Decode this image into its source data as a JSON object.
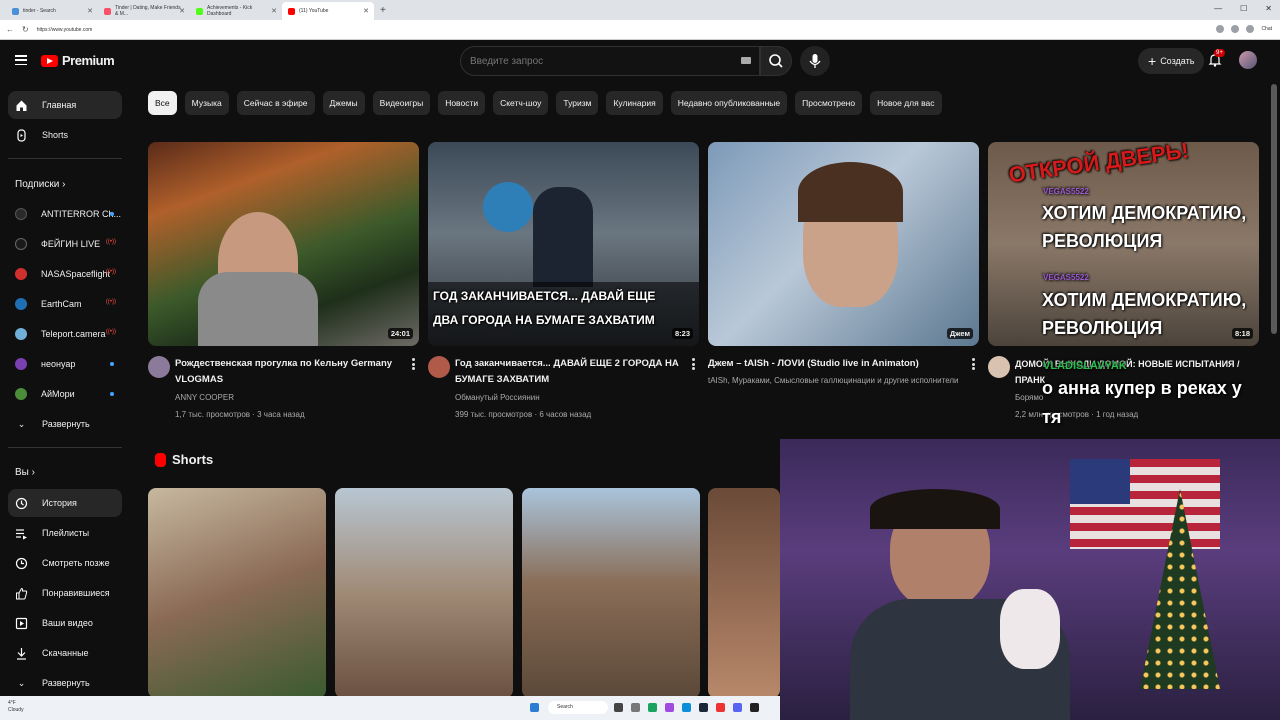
{
  "browser": {
    "tabs": [
      {
        "label": "tinder - Search",
        "active": false,
        "favicon_color": "#4a90d9"
      },
      {
        "label": "Tinder | Dating, Make Friends & M...",
        "active": false,
        "favicon_color": "#fd5068"
      },
      {
        "label": "Achievements - Kick Dashboard",
        "active": false,
        "favicon_color": "#53fc18"
      },
      {
        "label": "(11) YouTube",
        "active": true,
        "favicon_color": "#ff0000"
      }
    ],
    "new_tab": "+",
    "url": "https://www.youtube.com",
    "chat_label": "Chat"
  },
  "masthead": {
    "logo_text": "Premium",
    "search_placeholder": "Введите запрос",
    "create_label": "Создать",
    "notif_badge": "9+"
  },
  "sidebar": {
    "main": [
      {
        "label": "Главная",
        "icon": "home-icon",
        "active": true
      },
      {
        "label": "Shorts",
        "icon": "shorts-icon",
        "active": false
      }
    ],
    "subs_heading": "Подписки",
    "subs": [
      {
        "label": "ANTITERROR Ch...",
        "status": "dot",
        "color": "#2a2a2a"
      },
      {
        "label": "ФЕЙГИН LIVE",
        "status": "live",
        "color": "#1a1a1a"
      },
      {
        "label": "NASASpaceflight",
        "status": "live",
        "color": "#d22f2f"
      },
      {
        "label": "EarthCam",
        "status": "live",
        "color": "#1f6fb5"
      },
      {
        "label": "Teleport.camera",
        "status": "live",
        "color": "#6fb0d8"
      },
      {
        "label": "неонуар",
        "status": "dot",
        "color": "#7a3fb0"
      },
      {
        "label": "АйМори",
        "status": "dot",
        "color": "#4c8d3a"
      }
    ],
    "expand_label": "Развернуть",
    "you_heading": "Вы",
    "you": [
      {
        "label": "История",
        "icon": "history-icon",
        "active": true
      },
      {
        "label": "Плейлисты",
        "icon": "playlist-icon",
        "active": false
      },
      {
        "label": "Смотреть позже",
        "icon": "clock-icon",
        "active": false
      },
      {
        "label": "Понравившиеся",
        "icon": "like-icon",
        "active": false
      },
      {
        "label": "Ваши видео",
        "icon": "video-icon",
        "active": false
      },
      {
        "label": "Скачанные",
        "icon": "download-icon",
        "active": false
      },
      {
        "label": "Развернуть",
        "icon": "chevron-down-icon",
        "active": false
      }
    ]
  },
  "chips": [
    "Все",
    "Музыка",
    "Сейчас в эфире",
    "Джемы",
    "Видеоигры",
    "Новости",
    "Скетч-шоу",
    "Туризм",
    "Кулинария",
    "Недавно опубликованные",
    "Просмотрено",
    "Новое для вас"
  ],
  "videos": [
    {
      "title": "Рождественская прогулка по Кельну Germany VLOGMAS",
      "channel": "ANNY COOPER",
      "meta": "1,7 тыс. просмотров · 3 часа назад",
      "duration": "24:01"
    },
    {
      "title": "Год заканчивается... ДАВАЙ ЕЩЕ 2 ГОРОДА НА БУМАГЕ ЗАХВАТИМ",
      "channel": "Обманутый Россиянин",
      "meta": "399 тыс. просмотров · 6 часов назад",
      "duration": "8:23",
      "thumb_caption_1": "ГОД ЗАКАНЧИВАЕТСЯ... ДАВАЙ ЕЩЕ",
      "thumb_caption_2": "ДВА ГОРОДА НА БУМАГЕ ЗАХВАТИМ"
    },
    {
      "title": "Джем – tAISh - ЛOVИ (Studio live in Animaton)",
      "channel": "tAISh, Мураками, Смысловые галлюцинации и другие исполнители",
      "meta": "",
      "duration": "Джем"
    },
    {
      "title": "ДОМОЙ! ВЫХОДИ ДОМОЙ: НОВЫЕ ИСПЫТАНИЯ / ПРАНК",
      "channel": "Борямо",
      "meta": "2,2 млн просмотров · 1 год назад",
      "duration": "8:18",
      "thumb_caption": "ОТКРОЙ ДВЕРЬ!"
    }
  ],
  "shorts_heading": "Shorts",
  "overlay": {
    "user1": "VEGAS5522",
    "msg1a": "ХОТИМ ДЕМОКРАТИЮ,",
    "msg1b": "РЕВОЛЮЦИЯ",
    "user2": "VEGAS5522",
    "msg2a": "ХОТИМ ДЕМОКРАТИЮ,",
    "msg2b": "РЕВОЛЮЦИЯ",
    "user3": "VLADISLAVYAK",
    "msg3a": "о анна купер в реках у",
    "msg3b": "тя"
  },
  "taskbar": {
    "weather_temp": "4°F",
    "weather_desc": "Cloudy",
    "search_label": "Search"
  },
  "colors": {
    "accent": "#ff0000",
    "background": "#0f0f0f",
    "chip_active": "#f1f1f1"
  }
}
